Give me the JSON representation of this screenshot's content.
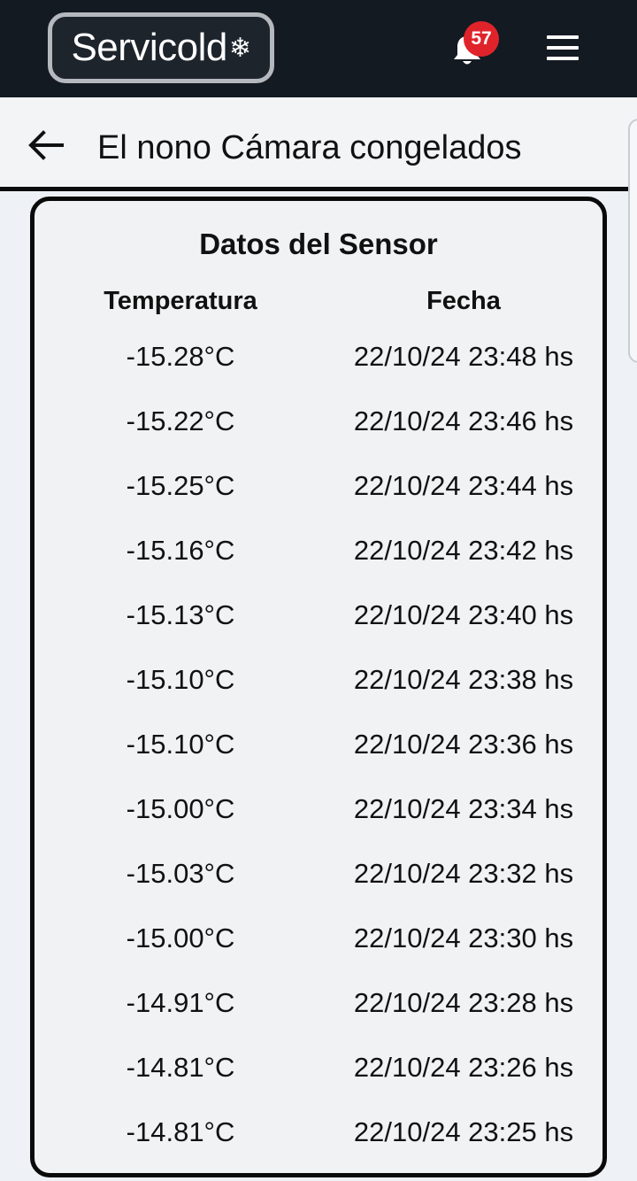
{
  "topbar": {
    "logo_text": "Servicold",
    "logo_icon": "snowflake-icon",
    "notification_count": "57",
    "bell_icon": "bell-icon",
    "menu_icon": "hamburger-menu-icon",
    "colors": {
      "background": "#141a22",
      "badge": "#e0232b"
    }
  },
  "header": {
    "back_icon": "arrow-left-icon",
    "title": "El nono Cámara congelados"
  },
  "sensor_card": {
    "title": "Datos del Sensor",
    "columns": {
      "temperature": "Temperatura",
      "date": "Fecha"
    },
    "rows": [
      {
        "temperature": "-15.28°C",
        "date": "22/10/24 23:48 hs"
      },
      {
        "temperature": "-15.22°C",
        "date": "22/10/24 23:46 hs"
      },
      {
        "temperature": "-15.25°C",
        "date": "22/10/24 23:44 hs"
      },
      {
        "temperature": "-15.16°C",
        "date": "22/10/24 23:42 hs"
      },
      {
        "temperature": "-15.13°C",
        "date": "22/10/24 23:40 hs"
      },
      {
        "temperature": "-15.10°C",
        "date": "22/10/24 23:38 hs"
      },
      {
        "temperature": "-15.10°C",
        "date": "22/10/24 23:36 hs"
      },
      {
        "temperature": "-15.00°C",
        "date": "22/10/24 23:34 hs"
      },
      {
        "temperature": "-15.03°C",
        "date": "22/10/24 23:32 hs"
      },
      {
        "temperature": "-15.00°C",
        "date": "22/10/24 23:30 hs"
      },
      {
        "temperature": "-14.91°C",
        "date": "22/10/24 23:28 hs"
      },
      {
        "temperature": "-14.81°C",
        "date": "22/10/24 23:26 hs"
      },
      {
        "temperature": "-14.81°C",
        "date": "22/10/24 23:25 hs"
      }
    ]
  }
}
